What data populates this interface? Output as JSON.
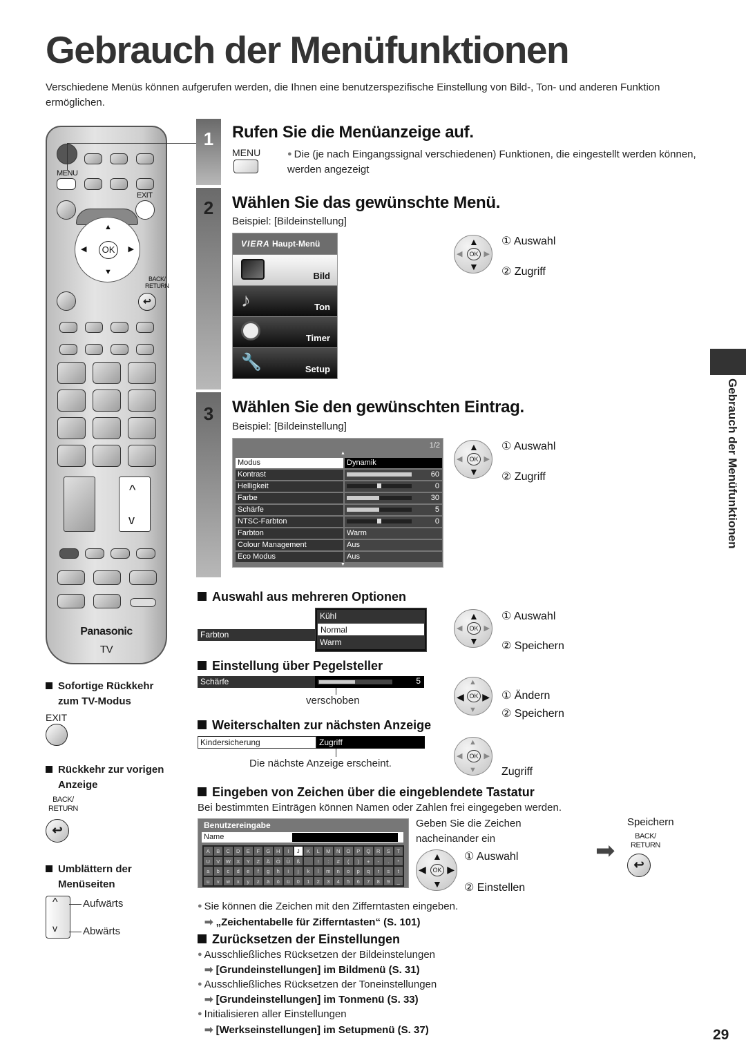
{
  "page": {
    "title": "Gebrauch der Menüfunktionen",
    "intro": "Verschiedene Menüs können aufgerufen werden, die Ihnen eine benutzerspezifische Einstellung von Bild-, Ton- und anderen Funktion ermöglichen.",
    "side_tab": "Gebrauch der Menüfunktionen",
    "page_number": "29"
  },
  "remote": {
    "menu_label": "MENU",
    "exit_label": "EXIT",
    "ok_label": "OK",
    "back_label_1": "BACK/",
    "back_label_2": "RETURN",
    "brand": "Panasonic",
    "mode": "TV",
    "up_arrow": "^",
    "down_arrow": "v"
  },
  "steps": [
    {
      "number": "1",
      "heading": "Rufen Sie die Menüanzeige auf.",
      "button_label": "MENU",
      "note": "Die (je nach Eingangssignal verschiedenen) Funktionen, die eingestellt werden können, werden angezeigt"
    },
    {
      "number": "2",
      "heading": "Wählen Sie das gewünschte Menü.",
      "example": "Beispiel: [Bildeinstellung]",
      "menu": {
        "header_logo": "VIERA",
        "header": "Haupt-Menü",
        "items": [
          {
            "label": "Bild",
            "selected": true,
            "icon": "tv-picture-icon"
          },
          {
            "label": "Ton",
            "selected": false,
            "icon": "music-note-icon"
          },
          {
            "label": "Timer",
            "selected": false,
            "icon": "clock-icon"
          },
          {
            "label": "Setup",
            "selected": false,
            "icon": "wrench-icon"
          }
        ]
      },
      "nav": {
        "select": "① Auswahl",
        "action": "② Zugriff"
      }
    },
    {
      "number": "3",
      "heading": "Wählen Sie den gewünschten Eintrag.",
      "example": "Beispiel: [Bildeinstellung]",
      "settings": {
        "page": "1/2",
        "rows": [
          {
            "key": "Modus",
            "value": "Dynamik",
            "selected": true
          },
          {
            "key": "Kontrast",
            "slider": 1.0,
            "value": "60"
          },
          {
            "key": "Helligkeit",
            "slider": 0.5,
            "centered": true,
            "value": "0"
          },
          {
            "key": "Farbe",
            "slider": 0.5,
            "value": "30"
          },
          {
            "key": "Schärfe",
            "slider": 0.5,
            "value": "5"
          },
          {
            "key": "NTSC-Farbton",
            "slider": 0.5,
            "centered": true,
            "value": "0"
          },
          {
            "key": "Farbton",
            "value": "Warm"
          },
          {
            "key": "Colour Management",
            "value": "Aus"
          },
          {
            "key": "Eco Modus",
            "value": "Aus"
          }
        ]
      },
      "nav": {
        "select": "① Auswahl",
        "action": "② Zugriff"
      }
    }
  ],
  "sections": {
    "options": {
      "heading": "Auswahl aus mehreren Optionen",
      "field": "Farbton",
      "choices": [
        "Kühl",
        "Normal",
        "Warm"
      ],
      "selected": "Normal",
      "nav": {
        "select": "① Auswahl",
        "action": "② Speichern"
      }
    },
    "slider": {
      "heading": "Einstellung über Pegelsteller",
      "field": "Schärfe",
      "level": 0.5,
      "value": "5",
      "caption": "verschoben",
      "nav": {
        "select": "① Ändern",
        "action": "② Speichern"
      }
    },
    "next": {
      "heading": "Weiterschalten zur nächsten Anzeige",
      "field": "Kindersicherung",
      "value": "Zugriff",
      "caption": "Die nächste Anzeige erscheint.",
      "nav": {
        "action": "Zugriff"
      }
    },
    "keyboard": {
      "heading": "Eingeben von Zeichen über die eingeblendete Tastatur",
      "desc": "Bei bestimmten Einträgen können Namen oder Zahlen frei eingegeben werden.",
      "title": "Benutzereingabe",
      "field": "Name",
      "selected_key": "J",
      "keys": [
        "A",
        "B",
        "C",
        "D",
        "E",
        "F",
        "G",
        "H",
        "I",
        "J",
        "K",
        "L",
        "M",
        "N",
        "O",
        "P",
        "Q",
        "R",
        "S",
        "T",
        "U",
        "V",
        "W",
        "X",
        "Y",
        "Z",
        "Ä",
        "Ö",
        "Ü",
        "ß",
        " ",
        "!",
        ":",
        "#",
        "(",
        ")",
        "+",
        "-",
        ".",
        "*",
        "a",
        "b",
        "c",
        "d",
        "e",
        "f",
        "g",
        "h",
        "i",
        "j",
        "k",
        "l",
        "m",
        "n",
        "o",
        "p",
        "q",
        "r",
        "s",
        "t",
        "u",
        "v",
        "w",
        "x",
        "y",
        "z",
        "ä",
        "ö",
        "ü",
        "0",
        "1",
        "2",
        "3",
        "4",
        "5",
        "6",
        "7",
        "8",
        "9",
        "_"
      ],
      "instruction_1": "Geben Sie die Zeichen",
      "instruction_2": "nacheinander ein",
      "nav": {
        "select": "① Auswahl",
        "action": "② Einstellen"
      },
      "save_label": "Speichern",
      "back_1": "BACK/",
      "back_2": "RETURN",
      "note": "Sie können die Zeichen mit den Zifferntasten eingeben.",
      "ref": "„Zeichentabelle für Zifferntasten“ (S. 101)"
    },
    "reset": {
      "heading": "Zurücksetzen der Einstellungen",
      "items": [
        {
          "text": "Ausschließliches Rücksetzen der Bildeinstelungen",
          "ref": "[Grundeinstellungen] im Bildmenü (S. 31)"
        },
        {
          "text": "Ausschließliches Rücksetzen der Toneinstellungen",
          "ref": "[Grundeinstellungen] im Tonmenü (S. 33)"
        },
        {
          "text": "Initialisieren aller Einstellungen",
          "ref": "[Werkseinstellungen] im Setupmenü (S. 37)"
        }
      ]
    }
  },
  "left_notes": {
    "exit": {
      "heading_1": "Sofortige Rückkehr",
      "heading_2": "zum TV-Modus",
      "button": "EXIT"
    },
    "back": {
      "heading_1": "Rückkehr zur vorigen",
      "heading_2": "Anzeige",
      "button_1": "BACK/",
      "button_2": "RETURN"
    },
    "page": {
      "heading_1": "Umblättern der",
      "heading_2": "Menüseiten",
      "up": "Aufwärts",
      "down": "Abwärts"
    }
  }
}
